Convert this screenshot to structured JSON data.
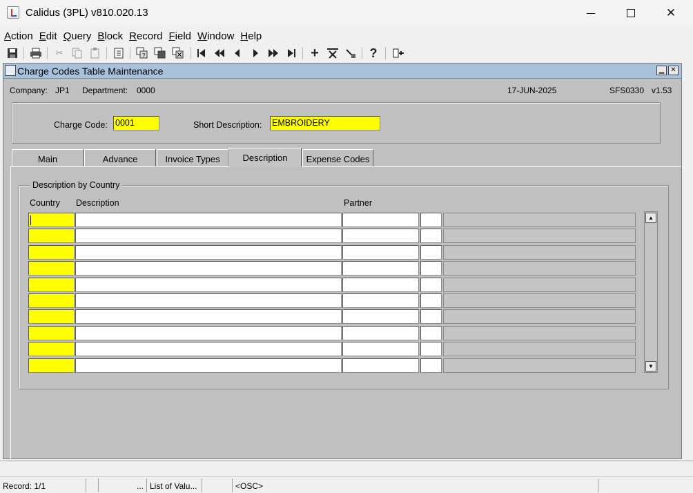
{
  "window": {
    "title": "Calidus (3PL) v810.020.13"
  },
  "menu": [
    {
      "ul": "A",
      "rest": "ction"
    },
    {
      "ul": "E",
      "rest": "dit"
    },
    {
      "ul": "Q",
      "rest": "uery"
    },
    {
      "ul": "B",
      "rest": "lock"
    },
    {
      "ul": "R",
      "rest": "ecord"
    },
    {
      "ul": "F",
      "rest": "ield"
    },
    {
      "ul": "W",
      "rest": "indow"
    },
    {
      "ul": "H",
      "rest": "elp"
    }
  ],
  "toolbar_icons": [
    "save-icon",
    "print-icon",
    "cut-icon",
    "copy-icon",
    "paste-icon",
    "clear-icon",
    "enter-query-icon",
    "execute-query-icon",
    "cancel-query-icon",
    "first-record-icon",
    "previous-block-icon",
    "previous-record-icon",
    "next-record-icon",
    "next-block-icon",
    "last-record-icon",
    "insert-record-icon",
    "delete-record-icon",
    "clear-record-icon",
    "help-icon",
    "exit-icon"
  ],
  "form": {
    "title": "Charge Codes Table Maintenance",
    "company_label": "Company:",
    "company": "JP1",
    "department_label": "Department:",
    "department": "0000",
    "date": "17-JUN-2025",
    "module": "SFS0330",
    "version": "v1.53",
    "charge_code_label": "Charge Code:",
    "charge_code": "0001",
    "short_desc_label": "Short Description:",
    "short_desc": "EMBROIDERY"
  },
  "tabs": [
    "Main",
    "Advance",
    "Invoice Types",
    "Description",
    "Expense Codes"
  ],
  "active_tab": "Description",
  "description_group": {
    "title": "Description by Country",
    "columns": {
      "country": "Country",
      "description": "Description",
      "partner": "Partner"
    },
    "rows": [
      {
        "country": "",
        "description": "",
        "partner": ""
      },
      {
        "country": "",
        "description": "",
        "partner": ""
      },
      {
        "country": "",
        "description": "",
        "partner": ""
      },
      {
        "country": "",
        "description": "",
        "partner": ""
      },
      {
        "country": "",
        "description": "",
        "partner": ""
      },
      {
        "country": "",
        "description": "",
        "partner": ""
      },
      {
        "country": "",
        "description": "",
        "partner": ""
      },
      {
        "country": "",
        "description": "",
        "partner": ""
      },
      {
        "country": "",
        "description": "",
        "partner": ""
      },
      {
        "country": "",
        "description": "",
        "partner": ""
      }
    ]
  },
  "status": {
    "record": "Record: 1/1",
    "dots": "...",
    "lov": "List of Valu...",
    "osc": "<OSC>"
  },
  "colors": {
    "required_field": "#ffff00",
    "form_bg": "#c0c0c0",
    "form_title": "#a9c2dc"
  }
}
